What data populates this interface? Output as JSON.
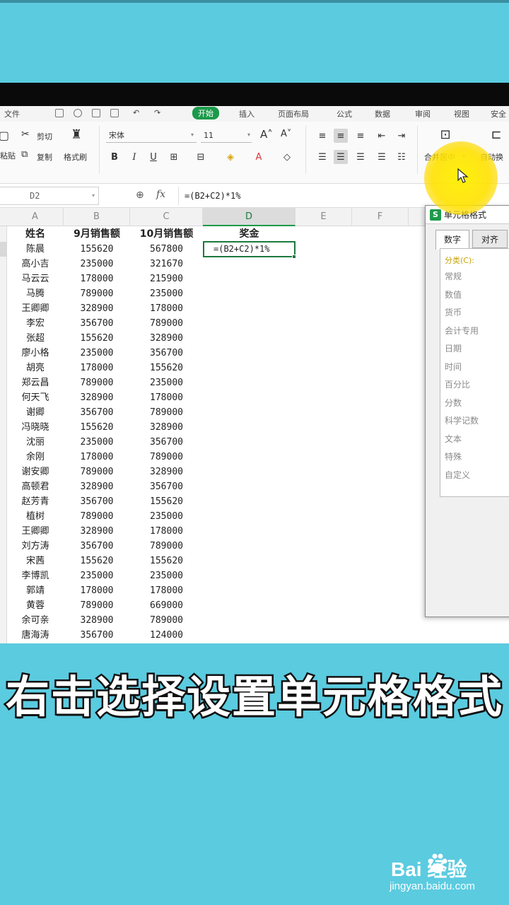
{
  "menu": {
    "items": [
      "文件",
      "开始",
      "插入",
      "页面布局",
      "公式",
      "数据",
      "审阅",
      "视图",
      "安全"
    ],
    "active": "开始"
  },
  "ribbon": {
    "cut": "剪切",
    "copy": "复制",
    "paste": "粘贴",
    "format_painter": "格式刷",
    "font_name": "宋体",
    "font_size": "11",
    "bold": "B",
    "italic": "I",
    "underline": "U",
    "merge_center": "合并居中",
    "auto_wrap": "自动换"
  },
  "formula_bar": {
    "name_box": "D2",
    "fx": "fx",
    "formula": "=(B2+C2)*1%"
  },
  "grid": {
    "columns": [
      "A",
      "B",
      "C",
      "D",
      "E",
      "F"
    ],
    "headers": [
      "姓名",
      "9月销售额",
      "10月销售额",
      "奖金"
    ],
    "active_cell_value": "=(B2+C2)*1%",
    "rows": [
      [
        "陈晨",
        "155620",
        "567800"
      ],
      [
        "高小吉",
        "235000",
        "321670"
      ],
      [
        "马云云",
        "178000",
        "215900"
      ],
      [
        "马腾",
        "789000",
        "235000"
      ],
      [
        "王卿卿",
        "328900",
        "178000"
      ],
      [
        "李宏",
        "356700",
        "789000"
      ],
      [
        "张超",
        "155620",
        "328900"
      ],
      [
        "廖小格",
        "235000",
        "356700"
      ],
      [
        "胡亮",
        "178000",
        "155620"
      ],
      [
        "郑云昌",
        "789000",
        "235000"
      ],
      [
        "何天飞",
        "328900",
        "178000"
      ],
      [
        "谢卿",
        "356700",
        "789000"
      ],
      [
        "冯晓晓",
        "155620",
        "328900"
      ],
      [
        "沈丽",
        "235000",
        "356700"
      ],
      [
        "余刚",
        "178000",
        "789000"
      ],
      [
        "谢安卿",
        "789000",
        "328900"
      ],
      [
        "高顿君",
        "328900",
        "356700"
      ],
      [
        "赵芳青",
        "356700",
        "155620"
      ],
      [
        "植树",
        "789000",
        "235000"
      ],
      [
        "王卿卿",
        "328900",
        "178000"
      ],
      [
        "刘方涛",
        "356700",
        "789000"
      ],
      [
        "宋茜",
        "155620",
        "155620"
      ],
      [
        "李博凯",
        "235000",
        "235000"
      ],
      [
        "郭靖",
        "178000",
        "178000"
      ],
      [
        "黄蓉",
        "789000",
        "669000"
      ],
      [
        "余可亲",
        "328900",
        "789000"
      ],
      [
        "唐海涛",
        "356700",
        "124000"
      ]
    ]
  },
  "dialog": {
    "title": "单元格格式",
    "logo": "S",
    "tabs": [
      "数字",
      "对齐"
    ],
    "group_label": "分类(C):",
    "categories": [
      "常规",
      "数值",
      "货币",
      "会计专用",
      "日期",
      "时间",
      "百分比",
      "分数",
      "科学记数",
      "文本",
      "特殊",
      "自定义"
    ]
  },
  "caption": "右击选择设置单元格格式",
  "watermark": {
    "logo": "Bai  经验",
    "url": "jingyan.baidu.com"
  },
  "colors": {
    "accent_green": "#1c9a4a",
    "background_cyan": "#5bcbe0",
    "highlight_yellow": "#ffe600"
  }
}
